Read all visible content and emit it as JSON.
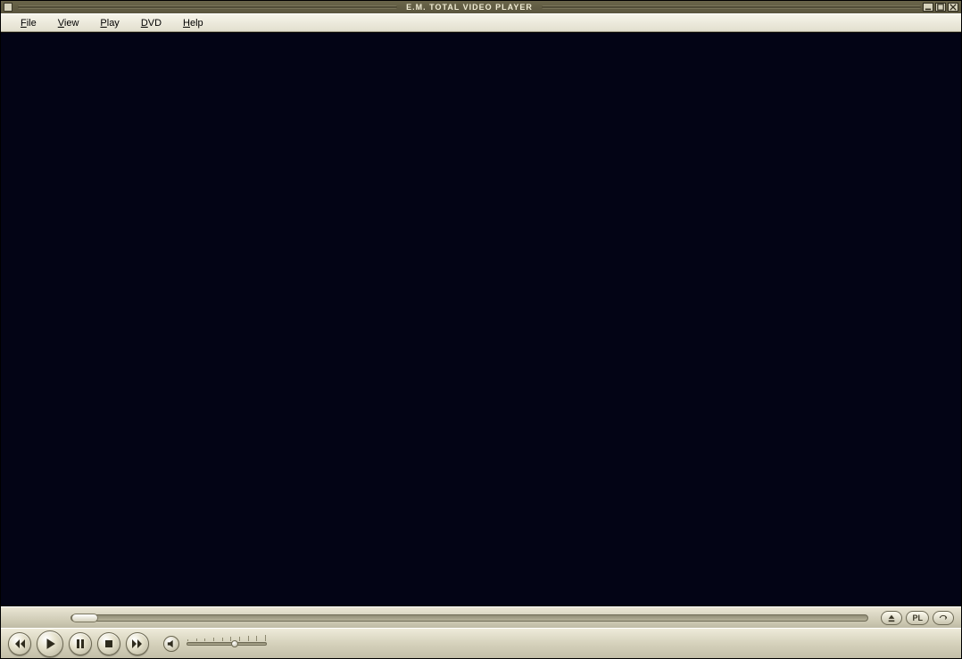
{
  "title": "E.M. TOTAL VIDEO PLAYER",
  "menu": {
    "file": "File",
    "view": "View",
    "play": "Play",
    "dvd": "DVD",
    "help": "Help"
  },
  "seek": {
    "position_pct": 0
  },
  "volume": {
    "level_pct": 60
  },
  "right_buttons": {
    "playlist_label": "PL"
  }
}
